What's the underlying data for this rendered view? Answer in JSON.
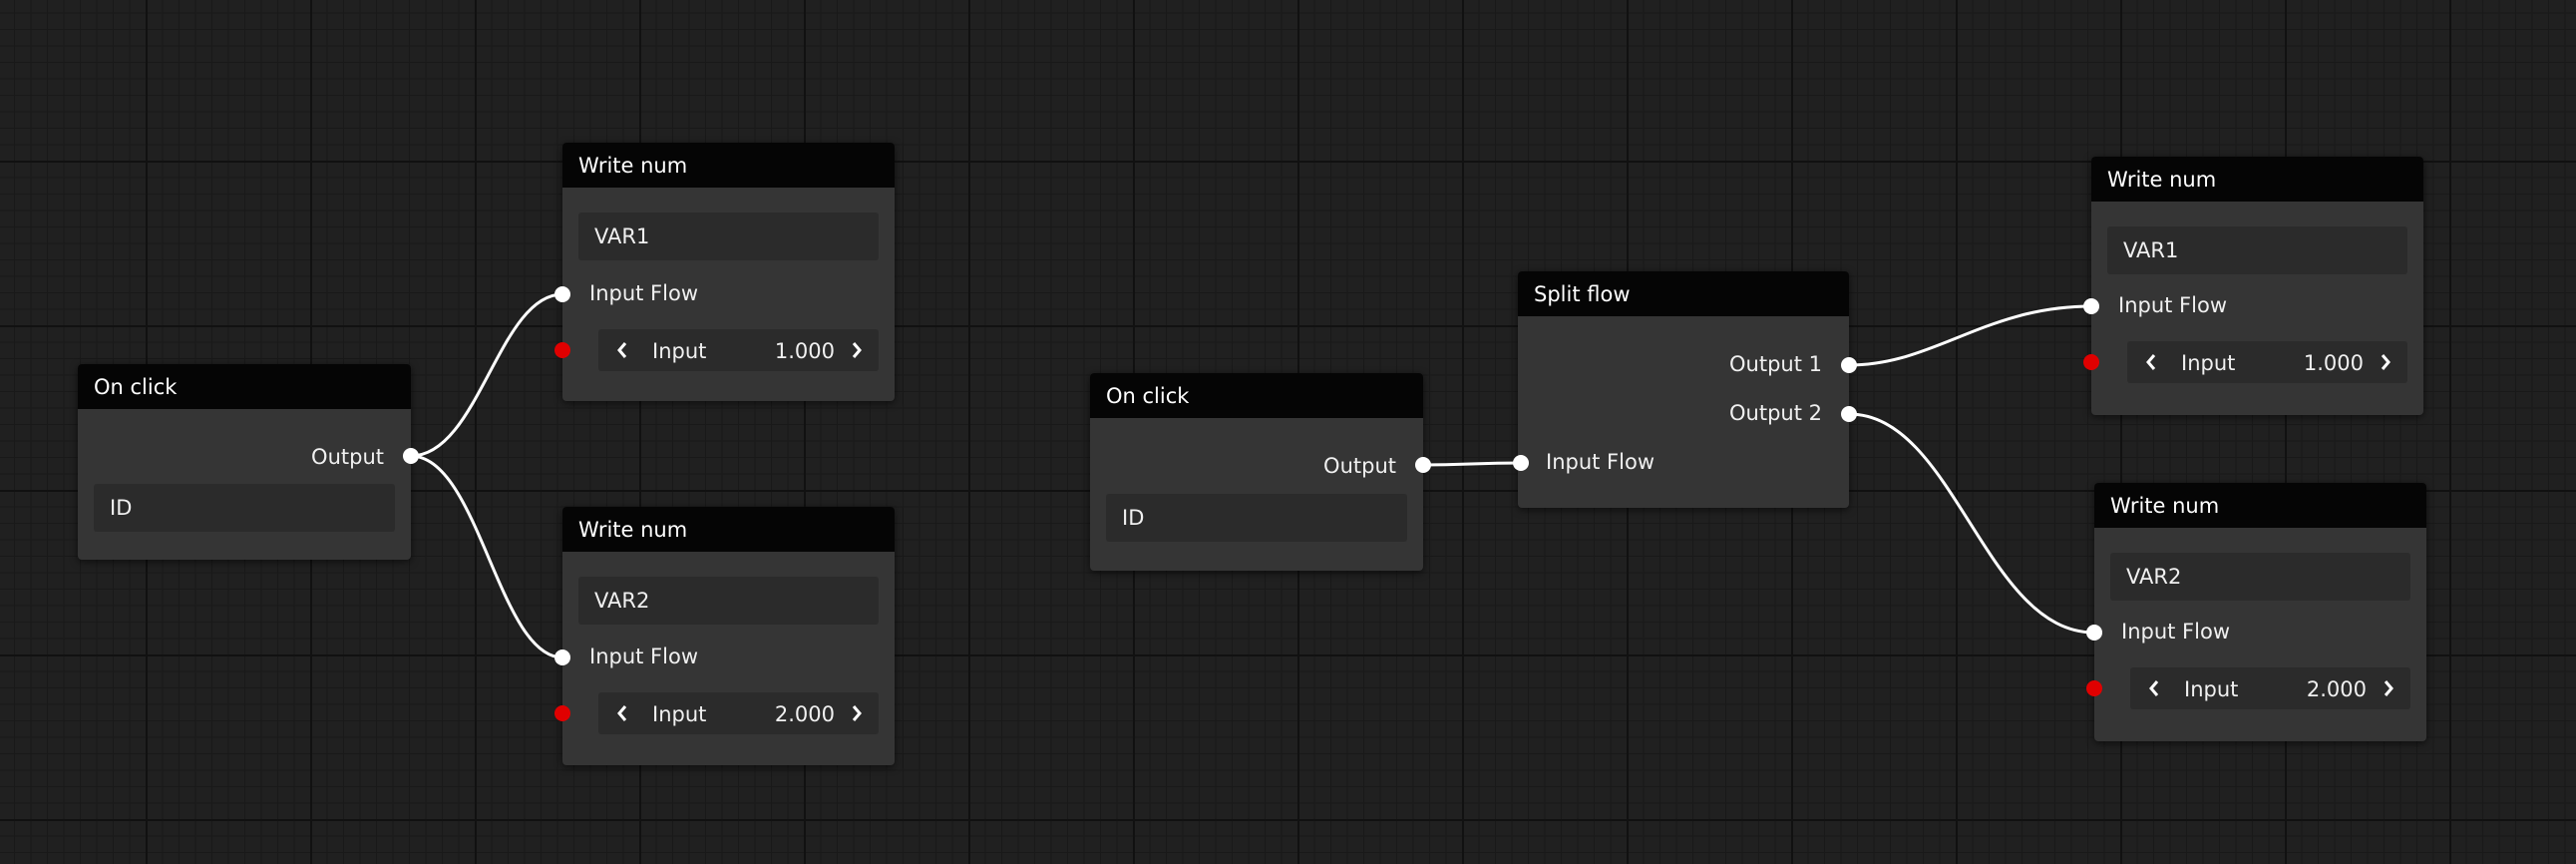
{
  "graph": {
    "left": {
      "on_click": {
        "title": "On click",
        "output_label": "Output",
        "id_field": "ID"
      },
      "write_num_1": {
        "title": "Write num",
        "variable": "VAR1",
        "flow_label": "Input Flow",
        "input_label": "Input",
        "input_value": "1.000"
      },
      "write_num_2": {
        "title": "Write num",
        "variable": "VAR2",
        "flow_label": "Input Flow",
        "input_label": "Input",
        "input_value": "2.000"
      }
    },
    "right": {
      "on_click": {
        "title": "On click",
        "output_label": "Output",
        "id_field": "ID"
      },
      "split_flow": {
        "title": "Split flow",
        "output1_label": "Output 1",
        "output2_label": "Output 2",
        "flow_label": "Input Flow"
      },
      "write_num_1": {
        "title": "Write num",
        "variable": "VAR1",
        "flow_label": "Input Flow",
        "input_label": "Input",
        "input_value": "1.000"
      },
      "write_num_2": {
        "title": "Write num",
        "variable": "VAR2",
        "flow_label": "Input Flow",
        "input_label": "Input",
        "input_value": "2.000"
      }
    }
  },
  "icons": {
    "decrement": "chevron-left-icon",
    "increment": "chevron-right-icon",
    "flow_port": "white-dot",
    "value_port": "red-dot"
  },
  "colors": {
    "canvas": "#202020",
    "node_body": "#353535",
    "node_header": "#050505",
    "field": "#2b2b2b",
    "port_flow": "#ffffff",
    "port_value": "#e00000",
    "wire": "#ffffff"
  }
}
